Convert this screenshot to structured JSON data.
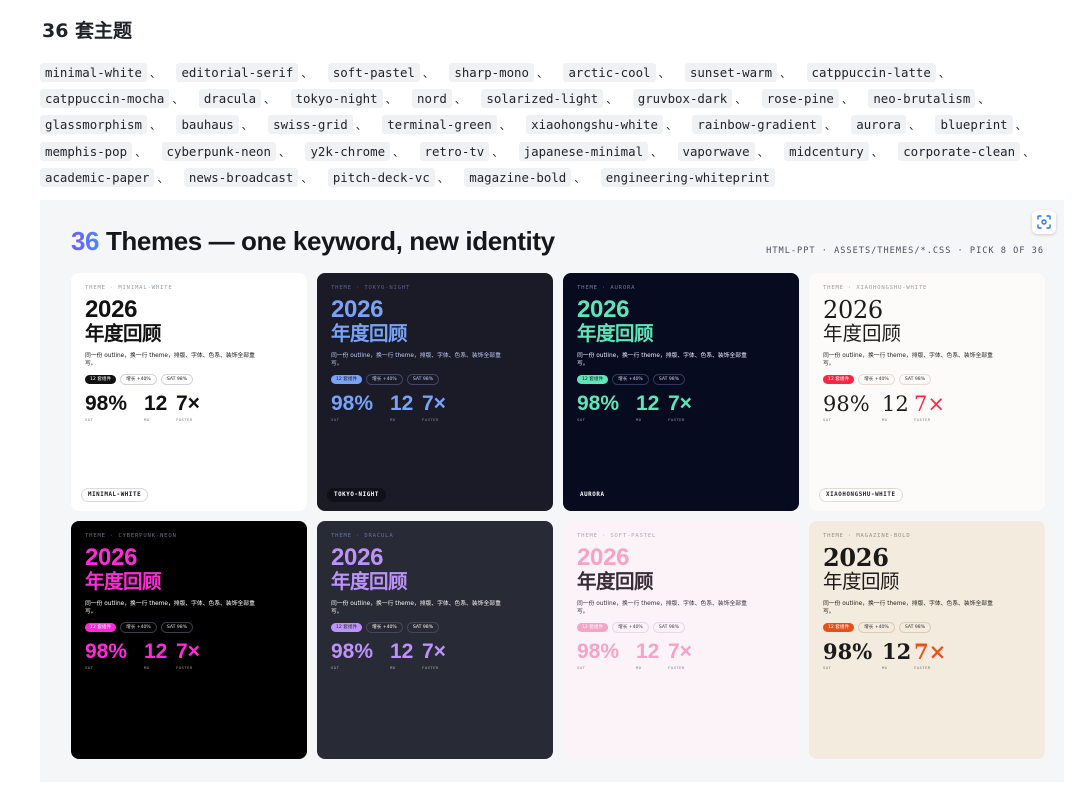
{
  "heading": "36 套主题",
  "tags": [
    "minimal-white",
    "editorial-serif",
    "soft-pastel",
    "sharp-mono",
    "arctic-cool",
    "sunset-warm",
    "catppuccin-latte",
    "catppuccin-mocha",
    "dracula",
    "tokyo-night",
    "nord",
    "solarized-light",
    "gruvbox-dark",
    "rose-pine",
    "neo-brutalism",
    "glassmorphism",
    "bauhaus",
    "swiss-grid",
    "terminal-green",
    "xiaohongshu-white",
    "rainbow-gradient",
    "aurora",
    "blueprint",
    "memphis-pop",
    "cyberpunk-neon",
    "y2k-chrome",
    "retro-tv",
    "japanese-minimal",
    "vaporwave",
    "midcentury",
    "corporate-clean",
    "academic-paper",
    "news-broadcast",
    "pitch-deck-vc",
    "magazine-bold",
    "engineering-whiteprint"
  ],
  "tag_separator": "、",
  "slide": {
    "title_number": "36",
    "title_text": " Themes — one keyword, new identity",
    "meta": "HTML-PPT · ASSETS/THEMES/*.CSS · PICK 8 OF 36"
  },
  "card_content": {
    "year": "2026",
    "cn_title": "年度回顾",
    "desc": "同一份 outline，换一行 theme，排版、字体、色系、装饰全部重写。",
    "pill_1": "12 套组件",
    "pill_2": "增长 +40%",
    "pill_3": "SAT 98%",
    "stat_1": "98%",
    "stat_2": "12",
    "stat_3": "7×",
    "stat_1_label": "SAT",
    "stat_2_label": "MO",
    "stat_3_label": "FASTER"
  },
  "cards": [
    {
      "eyebrow": "THEME · MINIMAL-WHITE",
      "badge": "MINIMAL-WHITE",
      "style": "sans",
      "bg": "#ffffff",
      "fg": "#111111",
      "muted": "#9aa0a6",
      "accent": "#111111",
      "pill_bg": "#111111",
      "pill_fg": "#ffffff",
      "pill_alt_bg": "#ffffff",
      "pill_alt_border": "#d0d4da",
      "pill_alt_fg": "#222222",
      "badge_bg": "#ffffff",
      "badge_fg": "#111111",
      "badge_border": "#d8dbe0"
    },
    {
      "eyebrow": "THEME · TOKYO-NIGHT",
      "badge": "TOKYO-NIGHT",
      "style": "sans",
      "bg": "#1a1b26",
      "fg": "#c0caf5",
      "muted": "#565f89",
      "accent": "#7aa2f7",
      "pill_bg": "#7aa2f7",
      "pill_fg": "#1a1b26",
      "pill_alt_bg": "#1a1b26",
      "pill_alt_border": "#414868",
      "pill_alt_fg": "#c0caf5",
      "badge_bg": "#0f1019",
      "badge_fg": "#ffffff",
      "badge_border": "#0f1019"
    },
    {
      "eyebrow": "THEME · AURORA",
      "badge": "AURORA",
      "style": "sans",
      "bg": "#070b1f",
      "fg": "#e9efff",
      "muted": "#6b7398",
      "accent": "#5ee6b8",
      "pill_bg": "#5ee6b8",
      "pill_fg": "#06201a",
      "pill_alt_bg": "#070b1f",
      "pill_alt_border": "#33395c",
      "pill_alt_fg": "#c9d1f0",
      "badge_bg": "#070b1f",
      "badge_fg": "#ffffff",
      "badge_border": "#070b1f"
    },
    {
      "eyebrow": "THEME · XIAOHONGSHU-WHITE",
      "badge": "XIAOHONGSHU-WHITE",
      "style": "serif",
      "bg": "#fdfbf9",
      "fg": "#1c1c1c",
      "muted": "#a59f99",
      "accent": "#ff2442",
      "pill_bg": "#ff2442",
      "pill_fg": "#ffffff",
      "pill_alt_bg": "#fdfbf9",
      "pill_alt_border": "#e5ddd6",
      "pill_alt_fg": "#333333",
      "badge_bg": "#ffffff",
      "badge_fg": "#222222",
      "badge_border": "#e2dcd6"
    },
    {
      "eyebrow": "THEME · CYBERPUNK-NEON",
      "badge": "",
      "style": "sans",
      "bg": "#000000",
      "fg": "#ffffff",
      "muted": "#6b6b80",
      "accent": "#ff2bd6",
      "year_color": "#ff2bd6",
      "pill_bg": "#ff2bd6",
      "pill_fg": "#ffffff",
      "pill_alt_bg": "#000000",
      "pill_alt_border": "#3a3a4a",
      "pill_alt_fg": "#dddddd",
      "badge_bg": "#000000",
      "badge_fg": "#ffffff",
      "badge_border": "#000000"
    },
    {
      "eyebrow": "THEME · DRACULA",
      "badge": "",
      "style": "sans",
      "bg": "#282a36",
      "fg": "#f8f8f2",
      "muted": "#6272a4",
      "accent": "#bd93f9",
      "pill_bg": "#bd93f9",
      "pill_fg": "#282a36",
      "pill_alt_bg": "#282a36",
      "pill_alt_border": "#44475a",
      "pill_alt_fg": "#f8f8f2",
      "badge_bg": "#282a36",
      "badge_fg": "#ffffff",
      "badge_border": "#282a36"
    },
    {
      "eyebrow": "THEME · SOFT-PASTEL",
      "badge": "",
      "style": "sans",
      "bg": "#fbf3f8",
      "fg": "#3b2b39",
      "muted": "#b7a6b3",
      "accent": "#f5a3c7",
      "pill_bg": "#f5a3c7",
      "pill_fg": "#ffffff",
      "pill_alt_bg": "#fbf3f8",
      "pill_alt_border": "#ead7e3",
      "pill_alt_fg": "#4a3a47",
      "badge_bg": "#fbf3f8",
      "badge_fg": "#222222",
      "badge_border": "#fbf3f8"
    },
    {
      "eyebrow": "THEME · MAGAZINE-BOLD",
      "badge": "",
      "style": "serif-bold",
      "bg": "#f3ebdd",
      "fg": "#1a1a1a",
      "muted": "#9c9282",
      "accent": "#e8501a",
      "pill_bg": "#e8501a",
      "pill_fg": "#ffffff",
      "pill_alt_bg": "#f3ebdd",
      "pill_alt_border": "#d9cdb8",
      "pill_alt_fg": "#333333",
      "badge_bg": "#f3ebdd",
      "badge_fg": "#222222",
      "badge_border": "#f3ebdd"
    }
  ]
}
